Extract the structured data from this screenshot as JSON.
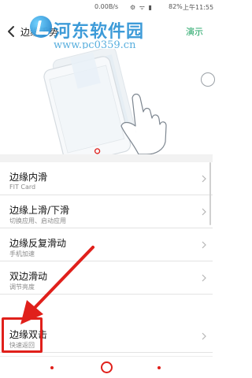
{
  "status_bar": {
    "speed": "0.00B/s",
    "signal_icons": "⚙ ᯤ ▮",
    "battery": "82%",
    "time": "上午11:55"
  },
  "title_bar": {
    "title": "边缘手势",
    "demo_label": "演示"
  },
  "watermark": {
    "title": "河东软件园",
    "url": "www.pc0359.cn"
  },
  "settings": {
    "items": [
      {
        "title": "边缘内滑",
        "subtitle": "FIT Card"
      },
      {
        "title": "边缘上滑/下滑",
        "subtitle": "切换应用、启动应用"
      },
      {
        "title": "边缘反复滑动",
        "subtitle": "手机加速"
      },
      {
        "title": "双边滑动",
        "subtitle": "调节亮度"
      },
      {
        "title": "边缘双击",
        "subtitle": "快速返回"
      }
    ]
  },
  "colors": {
    "accent": "#1aa260",
    "annotation": "#e0201b",
    "watermark": "#1c8ad2"
  },
  "icons": {
    "back": "back-arrow-icon",
    "chevron": "chevron-right-icon",
    "home": "home-circle-icon"
  }
}
